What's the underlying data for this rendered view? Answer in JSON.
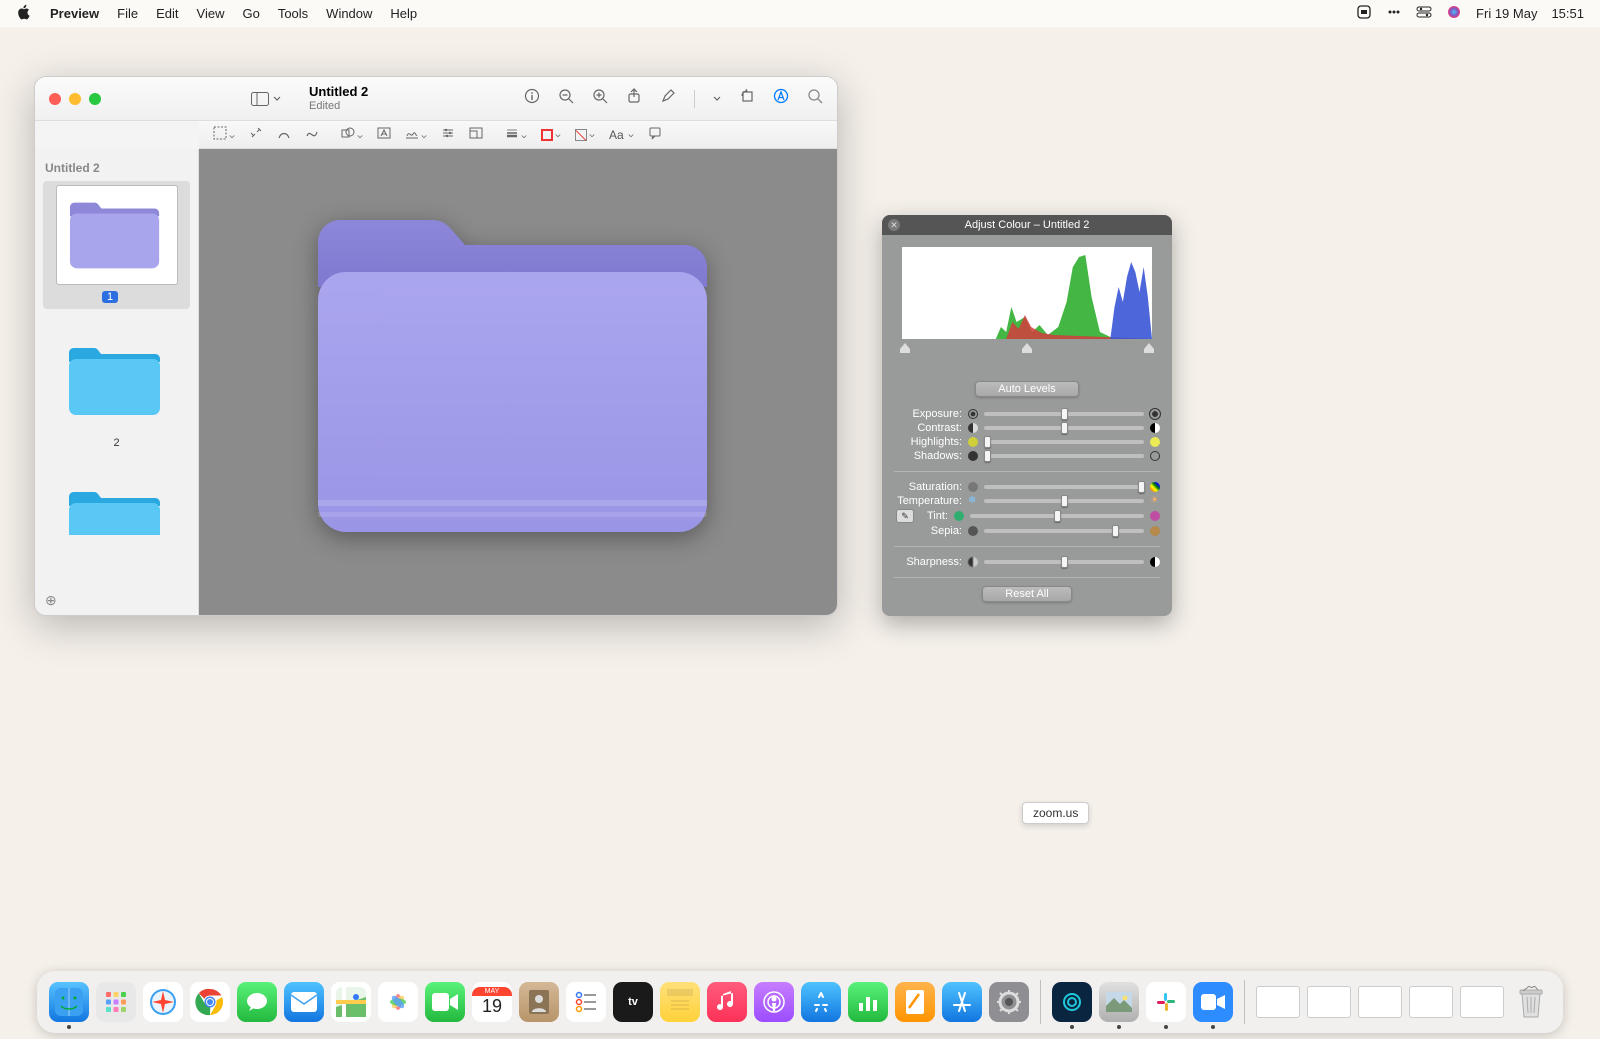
{
  "menubar": {
    "app": "Preview",
    "items": [
      "File",
      "Edit",
      "View",
      "Go",
      "Tools",
      "Window",
      "Help"
    ],
    "date": "Fri 19 May",
    "time": "15:51"
  },
  "preview": {
    "title": "Untitled 2",
    "subtitle": "Edited",
    "sidebar_label": "Untitled 2",
    "pages": {
      "p1": "1",
      "p2": "2"
    }
  },
  "adjust": {
    "title": "Adjust Colour – Untitled 2",
    "auto_levels": "Auto Levels",
    "reset_all": "Reset All",
    "sliders": {
      "exposure": {
        "label": "Exposure:",
        "pos": 50
      },
      "contrast": {
        "label": "Contrast:",
        "pos": 50
      },
      "highlights": {
        "label": "Highlights:",
        "pos": 2
      },
      "shadows": {
        "label": "Shadows:",
        "pos": 2
      },
      "saturation": {
        "label": "Saturation:",
        "pos": 98
      },
      "temperature": {
        "label": "Temperature:",
        "pos": 50
      },
      "tint": {
        "label": "Tint:",
        "pos": 50
      },
      "sepia": {
        "label": "Sepia:",
        "pos": 82
      },
      "sharpness": {
        "label": "Sharpness:",
        "pos": 50
      }
    }
  },
  "tooltip": {
    "text": "zoom.us"
  },
  "dock": {
    "apps": [
      {
        "name": "finder",
        "bg": "#1e9bf7"
      },
      {
        "name": "launchpad",
        "bg": "linear-gradient(#f5f5f5,#e5e5e5)"
      },
      {
        "name": "safari",
        "bg": "#1e9bf7"
      },
      {
        "name": "chrome",
        "bg": "#fff"
      },
      {
        "name": "messages",
        "bg": "#34c759"
      },
      {
        "name": "mail",
        "bg": "#1e9bf7"
      },
      {
        "name": "maps",
        "bg": "#fff"
      },
      {
        "name": "photos",
        "bg": "#fff"
      },
      {
        "name": "facetime",
        "bg": "#34c759"
      },
      {
        "name": "calendar",
        "bg": "#fff"
      },
      {
        "name": "contacts",
        "bg": "#c7a17a"
      },
      {
        "name": "reminders",
        "bg": "#fff"
      },
      {
        "name": "tv",
        "bg": "#222"
      },
      {
        "name": "notes",
        "bg": "#ffd54a"
      },
      {
        "name": "music",
        "bg": "#fc3158"
      },
      {
        "name": "podcasts",
        "bg": "#9b4dff"
      },
      {
        "name": "appstore",
        "bg": "#1e9bf7"
      },
      {
        "name": "numbers",
        "bg": "#34c759"
      },
      {
        "name": "pages",
        "bg": "#ff9500"
      },
      {
        "name": "appstore2",
        "bg": "#1e9bf7"
      },
      {
        "name": "settings",
        "bg": "#8e8e93"
      }
    ],
    "apps2": [
      {
        "name": "app-a",
        "bg": "#0a2540"
      },
      {
        "name": "app-b",
        "bg": "#d0d0d0"
      },
      {
        "name": "slack",
        "bg": "#fff"
      },
      {
        "name": "zoom",
        "bg": "#2d8cff"
      }
    ],
    "calendar_day": "19",
    "calendar_month": "MAY"
  }
}
